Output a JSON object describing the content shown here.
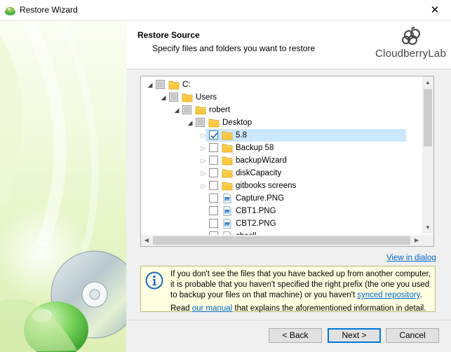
{
  "window": {
    "title": "Restore Wizard"
  },
  "header": {
    "title": "Restore Source",
    "subtitle": "Specify files and folders you want to restore",
    "brand": "CloudberryLab"
  },
  "tree": {
    "items": [
      {
        "label": "C:",
        "type": "folder",
        "state": "partial",
        "expander": "expanded"
      },
      {
        "label": "Users",
        "type": "folder",
        "state": "partial",
        "expander": "expanded"
      },
      {
        "label": "robert",
        "type": "folder",
        "state": "partial",
        "expander": "expanded"
      },
      {
        "label": "Desktop",
        "type": "folder",
        "state": "partial",
        "expander": "expanded"
      },
      {
        "label": "5.8",
        "type": "folder",
        "state": "checked",
        "expander": "collapsed",
        "selected": true
      },
      {
        "label": "Backup 58",
        "type": "folder",
        "state": "unchecked",
        "expander": "collapsed"
      },
      {
        "label": "backupWizard",
        "type": "folder",
        "state": "unchecked",
        "expander": "collapsed"
      },
      {
        "label": "diskCapacity",
        "type": "folder",
        "state": "unchecked",
        "expander": "collapsed"
      },
      {
        "label": "gitbooks screens",
        "type": "folder",
        "state": "unchecked",
        "expander": "collapsed"
      },
      {
        "label": "Capture.PNG",
        "type": "file",
        "state": "unchecked"
      },
      {
        "label": "CBT1.PNG",
        "type": "file",
        "state": "unchecked"
      },
      {
        "label": "CBT2.PNG",
        "type": "file",
        "state": "unchecked"
      },
      {
        "label": "checll...",
        "type": "file",
        "state": "unchecked"
      }
    ]
  },
  "view_link": "View in dialog",
  "info": {
    "text_before": "If you don't see the files that you have backed up from another computer, it is probable that you haven't specified the right prefix (the one you used to backup your files on that machine) or you haven't ",
    "synced_link": "synced repository",
    "text_after": ".",
    "read_before": "Read ",
    "manual_link": "our manual",
    "read_after": " that explains the aforementioned information in detail."
  },
  "buttons": {
    "back": "< Back",
    "next": "Next >",
    "cancel": "Cancel"
  },
  "colors": {
    "selection": "#cce8ff",
    "link": "#0066cc",
    "info_bg": "#ffffe1",
    "folder": "#ffc83d"
  }
}
